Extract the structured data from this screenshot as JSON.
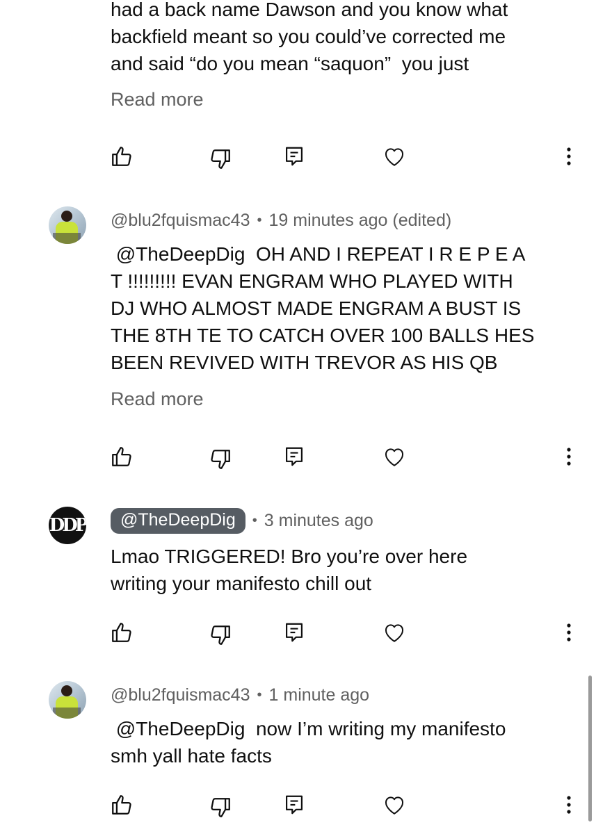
{
  "comments": [
    {
      "text": "had a back name Dawson and you know what\nbackfield meant so you could’ve corrected me\nand said “do you mean “saquon”  you just",
      "read_more": "Read more"
    },
    {
      "handle": "@blu2fquismac43",
      "separator": "•",
      "time": "19 minutes ago (edited)",
      "text": " @TheDeepDig  OH AND I REPEAT I R E P E A\nT !!!!!!!!! EVAN ENGRAM WHO PLAYED WITH\nDJ WHO ALMOST MADE ENGRAM A BUST IS\nTHE 8TH TE TO CATCH OVER 100 BALLS HES\nBEEN REVIVED WITH TREVOR AS HIS QB",
      "read_more": "Read more"
    },
    {
      "handle": "@TheDeepDig",
      "separator": "•",
      "time": "3 minutes ago",
      "avatar_letters": "DDP",
      "text": "Lmao TRIGGERED! Bro you’re over here\nwriting your manifesto chill out"
    },
    {
      "handle": "@blu2fquismac43",
      "separator": "•",
      "time": "1 minute ago",
      "text": " @TheDeepDig  now I’m writing my manifesto\nsmh yall hate facts"
    }
  ],
  "icons": {
    "like": "thumbs-up-icon",
    "dislike": "thumbs-down-icon",
    "reply": "reply-comment-icon",
    "heart": "heart-icon",
    "more": "more-vertical-icon"
  },
  "colors": {
    "text": "#0f0f0f",
    "secondary": "#606060",
    "pill": "#565c63",
    "background": "#ffffff"
  }
}
